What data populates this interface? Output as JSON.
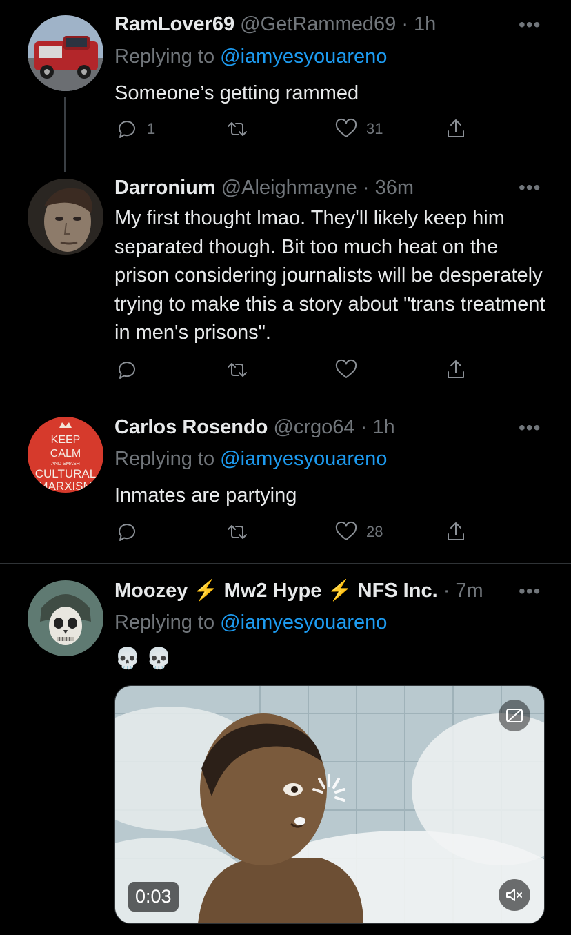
{
  "tweets": [
    {
      "name": "RamLover69",
      "handle": "@GetRammed69",
      "time": "· 1h",
      "replying_prefix": "Replying to ",
      "replying_to": "@iamyesyouareno",
      "text": "Someone’s getting rammed",
      "replies": "1",
      "retweets": "",
      "likes": "31",
      "avatar_icon": "red-pickup-truck"
    },
    {
      "name": "Darronium",
      "handle": "@Aleighmayne",
      "time": "· 36m",
      "text": "My first thought lmao. They'll likely keep him separated though. Bit too much heat on the prison considering journalists will be desperately trying to make this a story about \"trans treatment in men's prisons\".",
      "replies": "",
      "retweets": "",
      "likes": "",
      "avatar_icon": "game-character-face"
    },
    {
      "name": "Carlos Rosendo",
      "handle": "@crgo64",
      "time": "· 1h",
      "replying_prefix": "Replying to ",
      "replying_to": "@iamyesyouareno",
      "text": "Inmates are partying",
      "replies": "",
      "retweets": "",
      "likes": "28",
      "avatar_lines": [
        "KEEP",
        "CALM",
        "AND SMASH",
        "CULTURAL",
        "MARXISM"
      ]
    },
    {
      "name_parts": [
        "Moozey ",
        "⚡",
        " Mw2 Hype ",
        "⚡",
        " NFS Inc."
      ],
      "time": " · 7m",
      "replying_prefix": "Replying to ",
      "replying_to": "@iamyesyouareno",
      "text": "💀 💀",
      "video_time": "0:03",
      "avatar_icon": "skull-mask"
    }
  ],
  "more_label": "•••",
  "colors": {
    "background": "#000000",
    "text": "#e7e9ea",
    "muted": "#71767b",
    "link": "#1d9bf0"
  }
}
